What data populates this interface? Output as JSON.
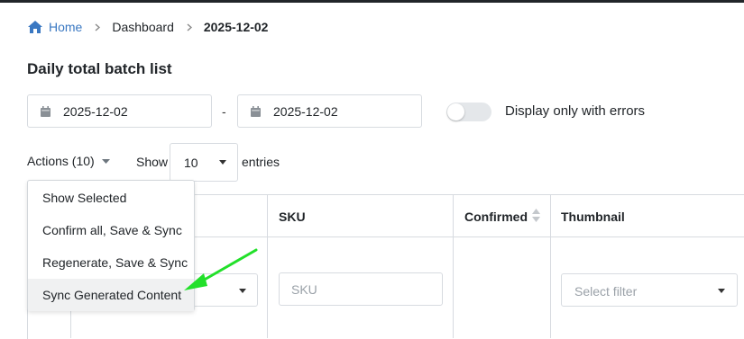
{
  "breadcrumb": {
    "home": "Home",
    "dashboard": "Dashboard",
    "current": "2025-12-02"
  },
  "page": {
    "title": "Daily total batch list"
  },
  "filters": {
    "date_from": "2025-12-02",
    "date_to": "2025-12-02",
    "dash": "-",
    "errors_toggle_label": "Display only with errors",
    "errors_toggle_on": false
  },
  "toolbar": {
    "actions_label": "Actions (10)",
    "show_label": "Show",
    "entries_value": "10",
    "entries_label": "entries"
  },
  "actions_menu": {
    "items": [
      "Show Selected",
      "Confirm all, Save & Sync",
      "Regenerate, Save & Sync",
      "Sync Generated Content"
    ],
    "highlighted_index": 3
  },
  "table": {
    "headers": {
      "sku": "SKU",
      "confirmed": "Confirmed",
      "thumbnail": "Thumbnail"
    },
    "sku_filter_placeholder": "SKU",
    "thumbnail_filter_placeholder": "Select filter"
  },
  "icons": {
    "home": "home-icon",
    "chevron": "chevron-right-icon",
    "calendar": "calendar-icon",
    "caret": "caret-down-icon",
    "sort": "sort-icon"
  },
  "colors": {
    "link": "#3a78c2",
    "annotation_arrow": "#22e02a",
    "border": "#d7dbe0"
  }
}
